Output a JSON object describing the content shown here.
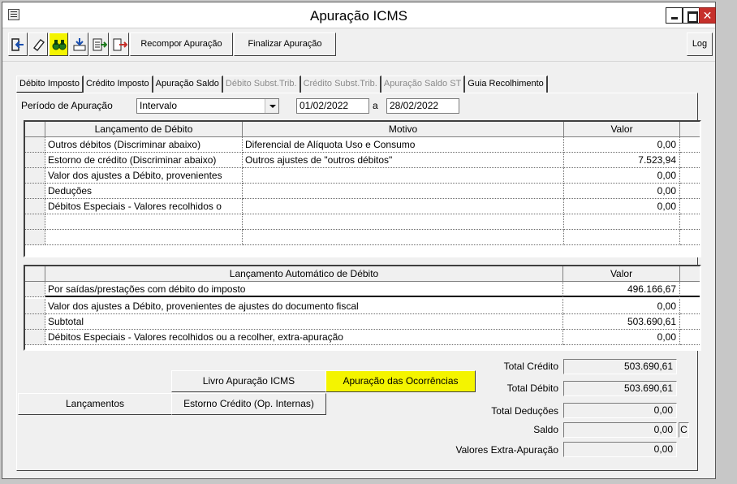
{
  "window": {
    "title": "Apuração ICMS"
  },
  "toolbar": {
    "icons": [
      "exit-icon",
      "eraser-icon",
      "binoculars-icon",
      "import-icon",
      "report-icon",
      "export-icon"
    ],
    "recompor_label": "Recompor Apuração",
    "finalizar_label": "Finalizar Apuração",
    "log_label": "Log"
  },
  "tabs": [
    {
      "label": "Débito Imposto",
      "state": "active"
    },
    {
      "label": "Crédito Imposto",
      "state": "enabled"
    },
    {
      "label": "Apuração Saldo",
      "state": "enabled"
    },
    {
      "label": "Débito Subst.Trib.",
      "state": "disabled"
    },
    {
      "label": "Crédito Subst.Trib.",
      "state": "disabled"
    },
    {
      "label": "Apuração Saldo ST",
      "state": "disabled"
    },
    {
      "label": "Guia Recolhimento",
      "state": "enabled"
    }
  ],
  "periodo": {
    "label": "Período de Apuração",
    "tipo": "Intervalo",
    "inicio": "01/02/2022",
    "separador": "a",
    "fim": "28/02/2022"
  },
  "debitos_table": {
    "columns": [
      "Lançamento de Débito",
      "Motivo",
      "Valor"
    ],
    "rows": [
      [
        "Outros débitos (Discriminar abaixo)",
        "Diferencial de Alíquota Uso e Consumo",
        "0,00"
      ],
      [
        "Estorno de crédito (Discriminar abaixo)",
        "Outros ajustes de \"outros débitos\"",
        "7.523,94"
      ],
      [
        "Valor dos ajustes a Débito, provenientes",
        "",
        "0,00"
      ],
      [
        "Deduções",
        "",
        "0,00"
      ],
      [
        "Débitos Especiais - Valores recolhidos o",
        "",
        "0,00"
      ],
      [
        "",
        "",
        ""
      ],
      [
        "",
        "",
        ""
      ]
    ]
  },
  "auto_table": {
    "columns": [
      "Lançamento Automático de Débito",
      "Valor"
    ],
    "rows": [
      [
        "Por saídas/prestações com débito do imposto",
        "496.166,67"
      ],
      [
        "Valor dos ajustes a Débito, provenientes de ajustes do documento fiscal",
        "0,00"
      ],
      [
        "Subtotal",
        "503.690,61"
      ],
      [
        "Débitos Especiais - Valores recolhidos ou a recolher, extra-apuração",
        "0,00"
      ]
    ]
  },
  "buttons": {
    "livro": "Livro Apuração ICMS",
    "ocorrencias": "Apuração das Ocorrências",
    "lancamentos": "Lançamentos",
    "estorno": "Estorno Crédito (Op. Internas)"
  },
  "totals": {
    "total_credito_label": "Total Crédito",
    "total_credito": "503.690,61",
    "total_debito_label": "Total Débito",
    "total_debito": "503.690,61",
    "total_deducoes_label": "Total Deduções",
    "total_deducoes": "0,00",
    "saldo_label": "Saldo",
    "saldo": "0,00",
    "saldo_flag": "C",
    "extra_label": "Valores Extra-Apuração",
    "extra": "0,00"
  },
  "colors": {
    "highlight": "#f4f400",
    "close_button": "#c6302b"
  }
}
